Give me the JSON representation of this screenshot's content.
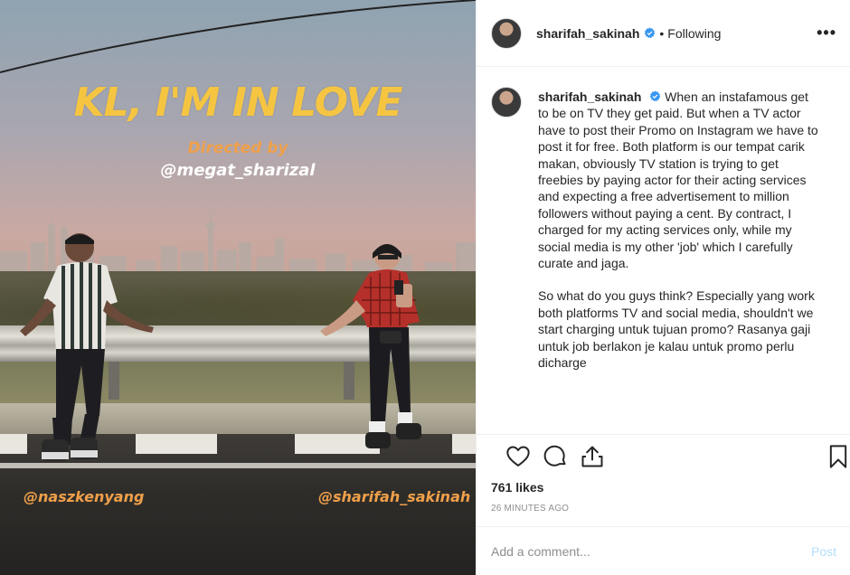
{
  "photo": {
    "title": "KL, I'M IN LOVE",
    "directed_by": "Directed by",
    "director": "@megat_sharizal",
    "tag_left": "@naszkenyang",
    "tag_right": "@sharifah_sakinah"
  },
  "header": {
    "username": "sharifah_sakinah",
    "verified": true,
    "separator": "•",
    "follow_status": "Following",
    "more": "•••"
  },
  "caption": {
    "username": "sharifah_sakinah",
    "paragraph1": "When an instafamous get to be on TV they get paid. But when a TV actor have to post their Promo on Instagram we have to post it for free. Both platform is our tempat carik makan, obviously TV station is trying to get freebies by paying actor for their acting services and expecting a free advertisement to million followers without paying a cent. By contract, I charged for my acting services only, while my social media is my other 'job' which I carefully curate and jaga.",
    "paragraph2": "So what do you guys think? Especially yang work both platforms TV and social media, shouldn't we start charging untuk tujuan promo? Rasanya gaji untuk job berlakon je kalau untuk promo perlu dicharge"
  },
  "actions": {
    "likes": "761 likes",
    "timestamp": "26 MINUTES AGO"
  },
  "comment": {
    "placeholder": "Add a comment...",
    "post_label": "Post"
  },
  "colors": {
    "verified_blue": "#3897f0",
    "title_yellow": "#f5c542",
    "tag_orange": "#f0a04a",
    "post_disabled": "#b2dffc"
  }
}
